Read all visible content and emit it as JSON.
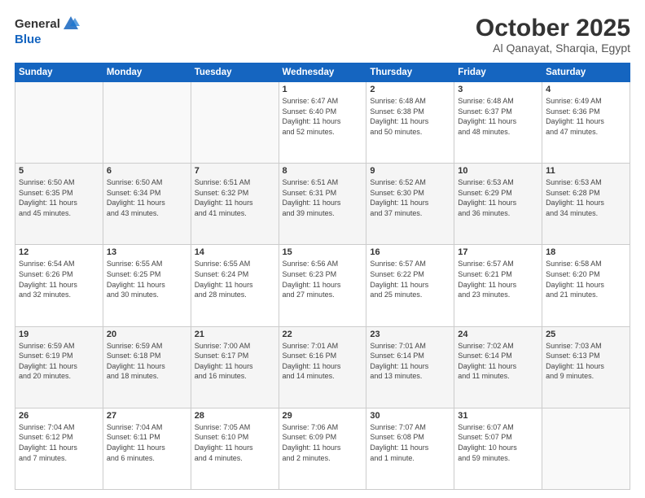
{
  "header": {
    "logo": {
      "text_general": "General",
      "text_blue": "Blue"
    },
    "title": "October 2025",
    "subtitle": "Al Qanayat, Sharqia, Egypt"
  },
  "weekdays": [
    "Sunday",
    "Monday",
    "Tuesday",
    "Wednesday",
    "Thursday",
    "Friday",
    "Saturday"
  ],
  "weeks": [
    [
      {
        "day": "",
        "info": ""
      },
      {
        "day": "",
        "info": ""
      },
      {
        "day": "",
        "info": ""
      },
      {
        "day": "1",
        "info": "Sunrise: 6:47 AM\nSunset: 6:40 PM\nDaylight: 11 hours\nand 52 minutes."
      },
      {
        "day": "2",
        "info": "Sunrise: 6:48 AM\nSunset: 6:38 PM\nDaylight: 11 hours\nand 50 minutes."
      },
      {
        "day": "3",
        "info": "Sunrise: 6:48 AM\nSunset: 6:37 PM\nDaylight: 11 hours\nand 48 minutes."
      },
      {
        "day": "4",
        "info": "Sunrise: 6:49 AM\nSunset: 6:36 PM\nDaylight: 11 hours\nand 47 minutes."
      }
    ],
    [
      {
        "day": "5",
        "info": "Sunrise: 6:50 AM\nSunset: 6:35 PM\nDaylight: 11 hours\nand 45 minutes."
      },
      {
        "day": "6",
        "info": "Sunrise: 6:50 AM\nSunset: 6:34 PM\nDaylight: 11 hours\nand 43 minutes."
      },
      {
        "day": "7",
        "info": "Sunrise: 6:51 AM\nSunset: 6:32 PM\nDaylight: 11 hours\nand 41 minutes."
      },
      {
        "day": "8",
        "info": "Sunrise: 6:51 AM\nSunset: 6:31 PM\nDaylight: 11 hours\nand 39 minutes."
      },
      {
        "day": "9",
        "info": "Sunrise: 6:52 AM\nSunset: 6:30 PM\nDaylight: 11 hours\nand 37 minutes."
      },
      {
        "day": "10",
        "info": "Sunrise: 6:53 AM\nSunset: 6:29 PM\nDaylight: 11 hours\nand 36 minutes."
      },
      {
        "day": "11",
        "info": "Sunrise: 6:53 AM\nSunset: 6:28 PM\nDaylight: 11 hours\nand 34 minutes."
      }
    ],
    [
      {
        "day": "12",
        "info": "Sunrise: 6:54 AM\nSunset: 6:26 PM\nDaylight: 11 hours\nand 32 minutes."
      },
      {
        "day": "13",
        "info": "Sunrise: 6:55 AM\nSunset: 6:25 PM\nDaylight: 11 hours\nand 30 minutes."
      },
      {
        "day": "14",
        "info": "Sunrise: 6:55 AM\nSunset: 6:24 PM\nDaylight: 11 hours\nand 28 minutes."
      },
      {
        "day": "15",
        "info": "Sunrise: 6:56 AM\nSunset: 6:23 PM\nDaylight: 11 hours\nand 27 minutes."
      },
      {
        "day": "16",
        "info": "Sunrise: 6:57 AM\nSunset: 6:22 PM\nDaylight: 11 hours\nand 25 minutes."
      },
      {
        "day": "17",
        "info": "Sunrise: 6:57 AM\nSunset: 6:21 PM\nDaylight: 11 hours\nand 23 minutes."
      },
      {
        "day": "18",
        "info": "Sunrise: 6:58 AM\nSunset: 6:20 PM\nDaylight: 11 hours\nand 21 minutes."
      }
    ],
    [
      {
        "day": "19",
        "info": "Sunrise: 6:59 AM\nSunset: 6:19 PM\nDaylight: 11 hours\nand 20 minutes."
      },
      {
        "day": "20",
        "info": "Sunrise: 6:59 AM\nSunset: 6:18 PM\nDaylight: 11 hours\nand 18 minutes."
      },
      {
        "day": "21",
        "info": "Sunrise: 7:00 AM\nSunset: 6:17 PM\nDaylight: 11 hours\nand 16 minutes."
      },
      {
        "day": "22",
        "info": "Sunrise: 7:01 AM\nSunset: 6:16 PM\nDaylight: 11 hours\nand 14 minutes."
      },
      {
        "day": "23",
        "info": "Sunrise: 7:01 AM\nSunset: 6:14 PM\nDaylight: 11 hours\nand 13 minutes."
      },
      {
        "day": "24",
        "info": "Sunrise: 7:02 AM\nSunset: 6:14 PM\nDaylight: 11 hours\nand 11 minutes."
      },
      {
        "day": "25",
        "info": "Sunrise: 7:03 AM\nSunset: 6:13 PM\nDaylight: 11 hours\nand 9 minutes."
      }
    ],
    [
      {
        "day": "26",
        "info": "Sunrise: 7:04 AM\nSunset: 6:12 PM\nDaylight: 11 hours\nand 7 minutes."
      },
      {
        "day": "27",
        "info": "Sunrise: 7:04 AM\nSunset: 6:11 PM\nDaylight: 11 hours\nand 6 minutes."
      },
      {
        "day": "28",
        "info": "Sunrise: 7:05 AM\nSunset: 6:10 PM\nDaylight: 11 hours\nand 4 minutes."
      },
      {
        "day": "29",
        "info": "Sunrise: 7:06 AM\nSunset: 6:09 PM\nDaylight: 11 hours\nand 2 minutes."
      },
      {
        "day": "30",
        "info": "Sunrise: 7:07 AM\nSunset: 6:08 PM\nDaylight: 11 hours\nand 1 minute."
      },
      {
        "day": "31",
        "info": "Sunrise: 6:07 AM\nSunset: 5:07 PM\nDaylight: 10 hours\nand 59 minutes."
      },
      {
        "day": "",
        "info": ""
      }
    ]
  ]
}
